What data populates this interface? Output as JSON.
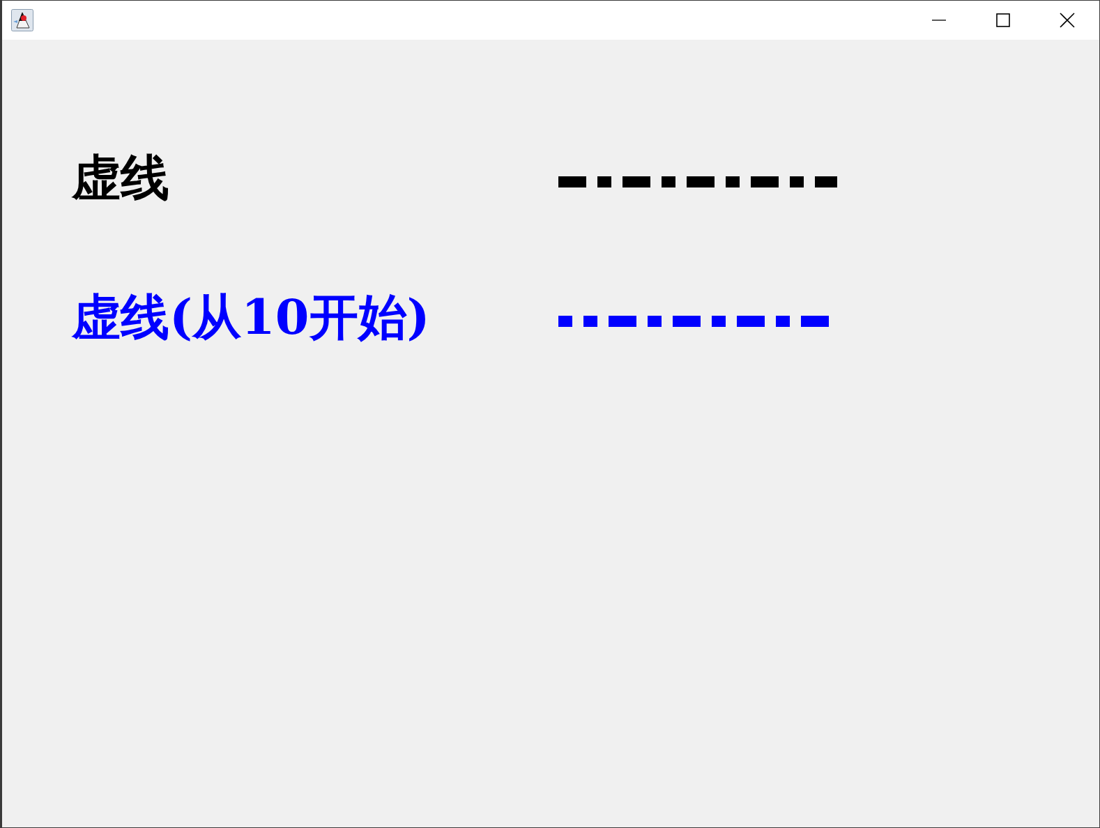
{
  "rows": [
    {
      "label": "虚线",
      "color": "#000000",
      "kind": "dashed"
    },
    {
      "label": "虚线(从10开始)",
      "color": "#0000ff",
      "kind": "dashed-offset"
    }
  ]
}
